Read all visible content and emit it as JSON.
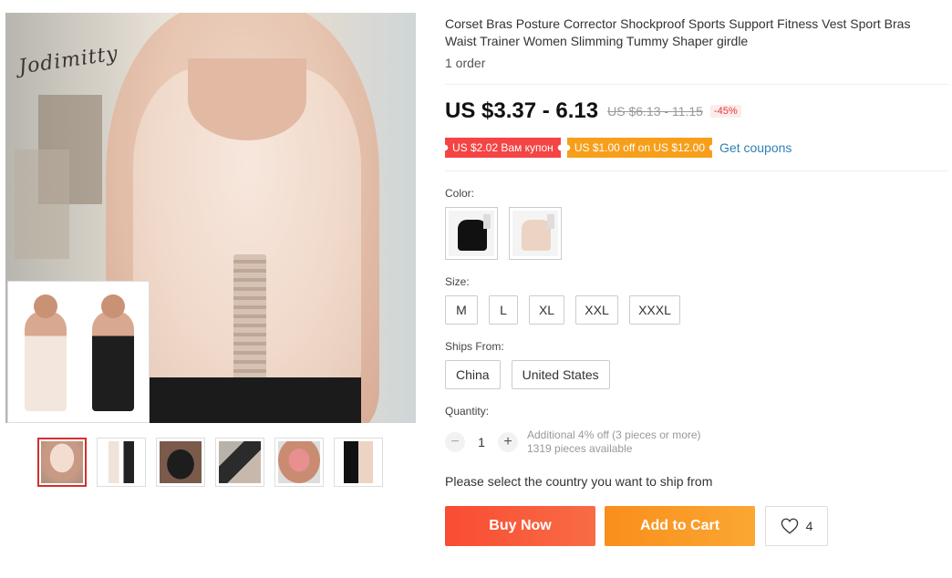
{
  "product": {
    "title": "Corset Bras Posture Corrector Shockproof Sports Support Fitness Vest Sport Bras Waist Trainer Women Slimming Tummy Shaper girdle",
    "orders": "1 order",
    "brand_logo": "Jodimitty"
  },
  "price": {
    "current": "US $3.37 - 6.13",
    "original": "US $6.13 - 11.15",
    "discount": "-45%"
  },
  "coupons": {
    "coupon1": "US $2.02 Вам купон",
    "coupon2": "US $1.00 off on US $12.00",
    "get_coupons": "Get coupons"
  },
  "color": {
    "label": "Color:",
    "options": [
      "black",
      "nude"
    ]
  },
  "size": {
    "label": "Size:",
    "options": [
      "M",
      "L",
      "XL",
      "XXL",
      "XXXL"
    ]
  },
  "ships_from": {
    "label": "Ships From:",
    "options": [
      "China",
      "United States"
    ]
  },
  "quantity": {
    "label": "Quantity:",
    "value": "1",
    "minus": "−",
    "plus": "+",
    "info1": "Additional 4% off (3 pieces or more)",
    "info2": "1319 pieces available"
  },
  "shipping_message": "Please select the country you want to ship from",
  "buttons": {
    "buy": "Buy Now",
    "cart": "Add to Cart",
    "wishlist_count": "4"
  },
  "colors": {
    "accent_red": "#f44444",
    "accent_orange": "#f79f1b",
    "link_blue": "#2e82b4"
  }
}
